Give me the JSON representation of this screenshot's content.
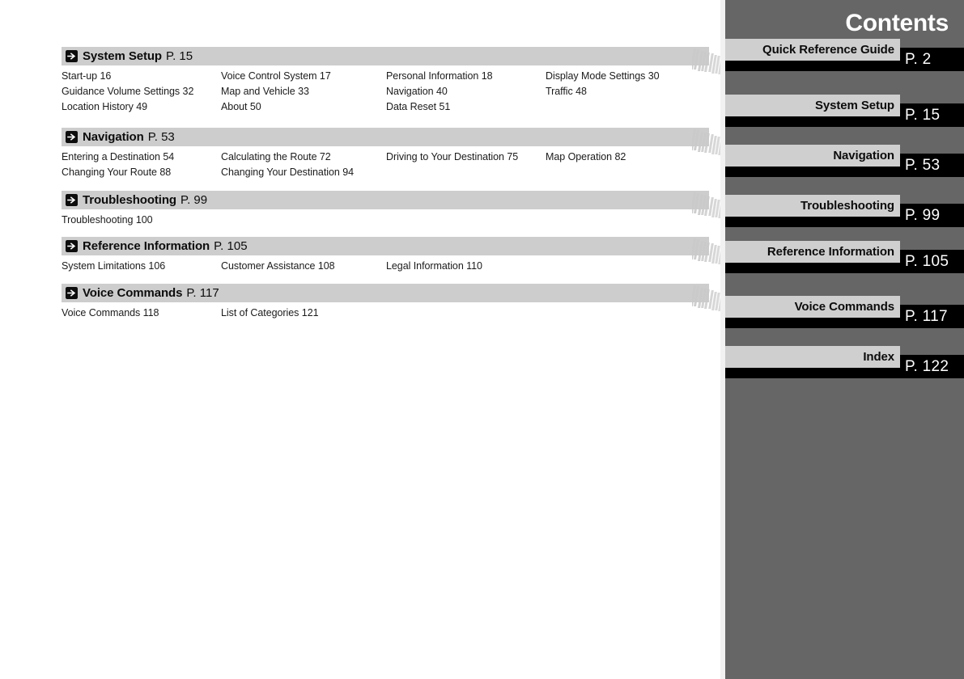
{
  "header": {
    "title": "Contents"
  },
  "icons": {
    "section_arrow": "arrow-right-boxed-icon"
  },
  "colors": {
    "rail_background": "#666666",
    "section_bar": "#cdcdcd",
    "tab_label_plate": "#cfcfcf",
    "tab_page_block": "#000000",
    "page_background": "#ffffff",
    "text": "#111111"
  },
  "toc": {
    "sections": [
      {
        "title": "System Setup",
        "page_label": "P. 15",
        "rows": [
          [
            "Start-up 16",
            "Voice Control System 17",
            "Personal Information 18",
            "Display Mode Settings 30"
          ],
          [
            "Guidance Volume Settings 32",
            "Map and Vehicle 33",
            "Navigation 40",
            "Traffic 48"
          ],
          [
            "Location History 49",
            "About 50",
            "Data Reset 51",
            ""
          ]
        ]
      },
      {
        "title": "Navigation",
        "page_label": "P. 53",
        "rows": [
          [
            "Entering a Destination 54",
            "Calculating the Route 72",
            "Driving to Your Destination 75",
            "Map Operation 82"
          ],
          [
            "Changing Your Route 88",
            "Changing Your Destination 94",
            "",
            ""
          ]
        ]
      },
      {
        "title": "Troubleshooting",
        "page_label": "P. 99",
        "rows": [
          [
            "Troubleshooting 100",
            "",
            "",
            ""
          ]
        ]
      },
      {
        "title": "Reference Information",
        "page_label": "P. 105",
        "rows": [
          [
            "System Limitations 106",
            "Customer Assistance 108",
            "Legal Information 110",
            ""
          ]
        ]
      },
      {
        "title": "Voice Commands",
        "page_label": "P. 117",
        "rows": [
          [
            "Voice Commands 118",
            "List of Categories 121",
            "",
            ""
          ]
        ]
      }
    ]
  },
  "rail": {
    "tabs": [
      {
        "label": "Quick Reference Guide",
        "page_label": "P. 2"
      },
      {
        "label": "System Setup",
        "page_label": "P. 15"
      },
      {
        "label": "Navigation",
        "page_label": "P. 53"
      },
      {
        "label": "Troubleshooting",
        "page_label": "P. 99"
      },
      {
        "label": "Reference Information",
        "page_label": "P. 105"
      },
      {
        "label": "Voice Commands",
        "page_label": "P. 117"
      },
      {
        "label": "Index",
        "page_label": "P. 122"
      }
    ]
  }
}
